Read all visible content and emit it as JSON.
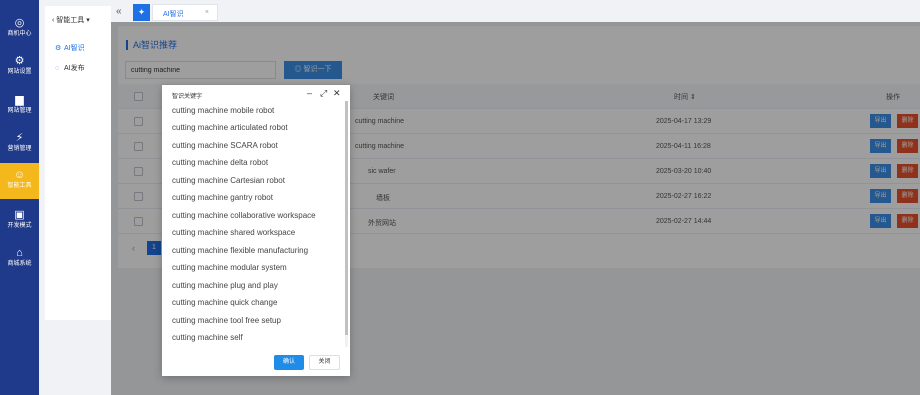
{
  "sidebar": {
    "items": [
      {
        "label": "商机中心",
        "icon": "target-icon"
      },
      {
        "label": "网站设置",
        "icon": "gear-icon"
      },
      {
        "label": "网站管理",
        "icon": "monitor-icon"
      },
      {
        "label": "营销管理",
        "icon": "marketing-icon"
      },
      {
        "label": "智能工具",
        "icon": "smart-tool-icon",
        "active": true
      },
      {
        "label": "开发模式",
        "icon": "code-icon"
      },
      {
        "label": "商城系统",
        "icon": "shop-icon"
      }
    ],
    "active_color": "#f5b81c",
    "bg_color": "#1f3a8a"
  },
  "subnav": {
    "title": "智能工具",
    "items": [
      {
        "label": "AI智识",
        "icon": "gear-icon",
        "active": true
      },
      {
        "label": "AI发布",
        "icon": "chat-icon"
      }
    ]
  },
  "tabs": {
    "collapse_glyph": "«",
    "items": [
      {
        "label": "AI智识",
        "close": "×"
      }
    ]
  },
  "main": {
    "page_title": "Ai智识推荐",
    "search": {
      "value": "cutting machine",
      "button_label": "智识一下"
    },
    "table": {
      "headers": {
        "keyword": "关键词",
        "time": "时间 ⇕",
        "actions": "操作"
      },
      "rows": [
        {
          "keyword": "cutting machine",
          "time": "2025-04-17 13:29"
        },
        {
          "keyword": "cutting machine",
          "time": "2025-04-11 16:28"
        },
        {
          "keyword": "sic wafer",
          "time": "2025-03-20 10:40"
        },
        {
          "keyword": "墙板",
          "time": "2025-02-27 16:22"
        },
        {
          "keyword": "外贸网站",
          "time": "2025-02-27 14:44"
        }
      ],
      "export_label": "导出",
      "delete_label": "删除"
    },
    "pager": {
      "prev": "‹",
      "current_page": "1"
    }
  },
  "modal": {
    "title": "智识关键字",
    "keywords": [
      "cutting machine mobile robot",
      "cutting machine articulated robot",
      "cutting machine SCARA robot",
      "cutting machine delta robot",
      "cutting machine Cartesian robot",
      "cutting machine gantry robot",
      "cutting machine collaborative workspace",
      "cutting machine shared workspace",
      "cutting machine flexible manufacturing",
      "cutting machine modular system",
      "cutting machine plug and play",
      "cutting machine quick change",
      "cutting machine tool free setup",
      "cutting machine self"
    ],
    "ok_label": "确认",
    "close_label": "关闭"
  }
}
